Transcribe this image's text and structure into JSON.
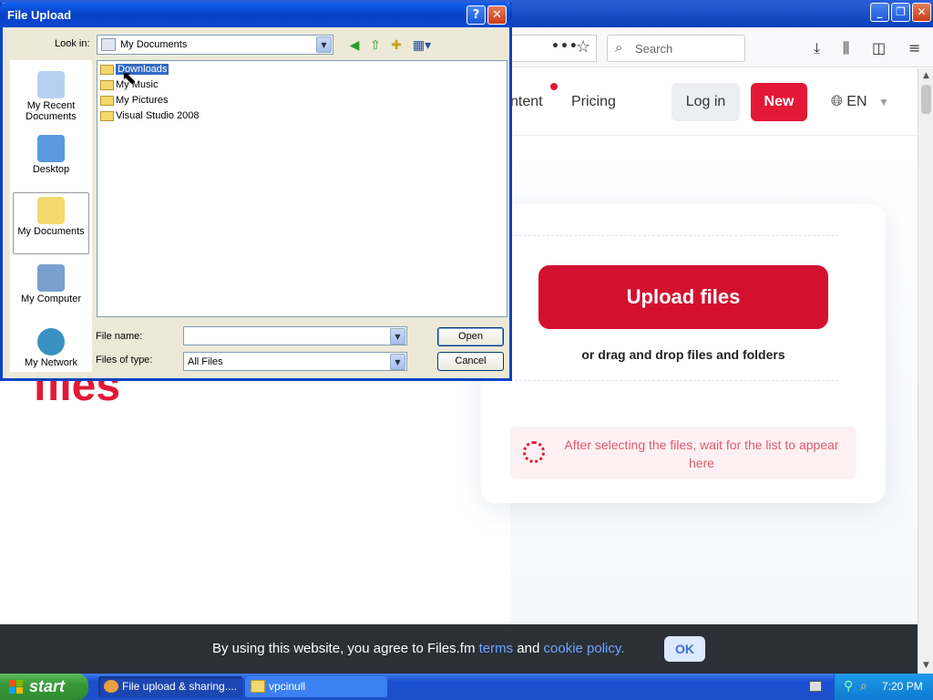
{
  "dialog": {
    "title": "File Upload",
    "help_label": "?",
    "close_label": "✕",
    "look_in_label": "Look in:",
    "look_in_value": "My Documents",
    "places": [
      {
        "label": "My Recent Documents"
      },
      {
        "label": "Desktop"
      },
      {
        "label": "My Documents"
      },
      {
        "label": "My Computer"
      },
      {
        "label": "My Network"
      }
    ],
    "files": [
      {
        "name": "Downloads",
        "selected": true
      },
      {
        "name": "My Music"
      },
      {
        "name": "My Pictures"
      },
      {
        "name": "Visual Studio 2008"
      }
    ],
    "file_name_label": "File name:",
    "file_name_value": "",
    "files_of_type_label": "Files of type:",
    "files_of_type_value": "All Files",
    "open_label": "Open",
    "cancel_label": "Cancel"
  },
  "browser": {
    "search_placeholder": "Search",
    "url_dots": "•••"
  },
  "site": {
    "nav_partial": "ntent",
    "pricing": "Pricing",
    "login": "Log in",
    "new": "New",
    "lang": "EN",
    "hero_word": "files",
    "upload_button": "Upload files",
    "drag_text": "or drag and drop files and folders",
    "notice": "After selecting the files, wait for the list to appear here",
    "accent_color": "#e31837"
  },
  "cookie": {
    "text_before": "By using this website, you agree to Files.fm ",
    "terms": "terms",
    "and": " and ",
    "policy": "cookie policy.",
    "ok": "OK"
  },
  "taskbar": {
    "start": "start",
    "items": [
      {
        "label": "File upload & sharing...."
      },
      {
        "label": "vpcinull"
      }
    ],
    "time": "7:20 PM"
  }
}
